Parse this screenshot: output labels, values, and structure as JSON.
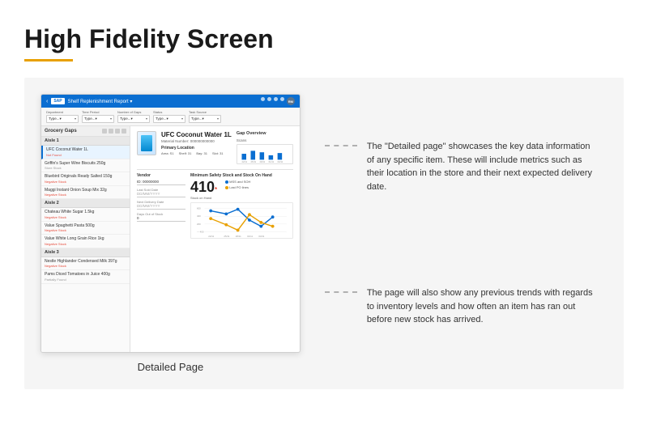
{
  "page": {
    "title": "High Fidelity Screen",
    "title_underline_color": "#e8a000"
  },
  "sap": {
    "back_icon": "‹",
    "logo": "SAP",
    "title": "Shelf Replenishment Report ▾",
    "avatar": "RM"
  },
  "filters": {
    "department": {
      "label": "Department",
      "placeholder": "Type..."
    },
    "time_period": {
      "label": "Time Period",
      "placeholder": "Type..."
    },
    "number_of_gaps": {
      "label": "Number of Gaps",
      "placeholder": "Type..."
    },
    "status": {
      "label": "Status",
      "placeholder": "Type..."
    },
    "task_source": {
      "label": "Task Source",
      "placeholder": "Type..."
    }
  },
  "sidebar": {
    "title": "Grocery Gaps",
    "aisle1": {
      "label": "Aisle 1",
      "items": [
        {
          "name": "UFC Coconut Water 1L",
          "status": "Not Found",
          "selected": true
        },
        {
          "name": "Griffin's Super Wine Biscuits 250g",
          "status": "Store Stock"
        },
        {
          "name": "Bluebird Originals Ready Salted 150g",
          "status": "Negative Stock"
        },
        {
          "name": "Maggi Instant Onion Soup Mix 32g",
          "status": "Negative Stock"
        }
      ]
    },
    "aisle2": {
      "label": "Aisle 2",
      "items": [
        {
          "name": "Chateau White Sugar 1.5kg",
          "status": "Negative Stock"
        },
        {
          "name": "Value Spaghetti Pasta 500g",
          "status": "Negative Stock"
        },
        {
          "name": "Value White Long Grain Rice 1kg",
          "status": "Negative Stock"
        }
      ]
    },
    "aisle3": {
      "label": "Aisle 3",
      "items": [
        {
          "name": "Nestle Highlander Condensed Milk 397g",
          "status": "Negative Stock"
        },
        {
          "name": "Pams Diced Tomatoes in Juice 400g",
          "status": "Partially Found"
        }
      ]
    }
  },
  "detail": {
    "product_name": "UFC Coconut Water 1L",
    "material_number": "Material Number: 000000000000",
    "primary_location_label": "Primary Location",
    "location_area": "Area: S1",
    "location_shelf": "Shelf: 31",
    "location_bay": "Bay: 31",
    "location_slot": "Slot: 31",
    "gap_overview_label": "Gap Overview",
    "scans_label": "Scans",
    "scan_dates": [
      "22/11",
      "25/11",
      "28/11",
      "01/11",
      "03/11"
    ],
    "vendor_label": "Vendor",
    "vendor_id_label": "ID: 00000000",
    "last_sold_label": "Last Sold Date",
    "last_sold_placeholder": "DD/MM/YYYY",
    "next_delivery_label": "Next Delivery Date",
    "next_delivery_placeholder": "DD/MM/YYYY",
    "days_out_label": "Days Out of Stock",
    "days_out_value": "0",
    "min_safety_label": "Minimum Safety Stock and Stock On Hand",
    "big_stock_number": "410",
    "big_stock_asterisk": "*",
    "stock_on_hand_label": "Stock on Hand",
    "legend_mss": "MSS and SOH",
    "legend_last_po": "Last PO lines",
    "chart_dates": [
      "22/11",
      "25/11",
      "28/11",
      "01/11",
      "03/11"
    ]
  },
  "annotations": {
    "annotation1": "The \"Detailed page\" showcases the key data information of any specific item. These will include metrics such as their location in the store and their next expected delivery date.",
    "annotation2": "The page will also show any previous trends with regards to inventory levels and how often an item has ran out before new stock has arrived."
  },
  "caption": "Detailed Page"
}
